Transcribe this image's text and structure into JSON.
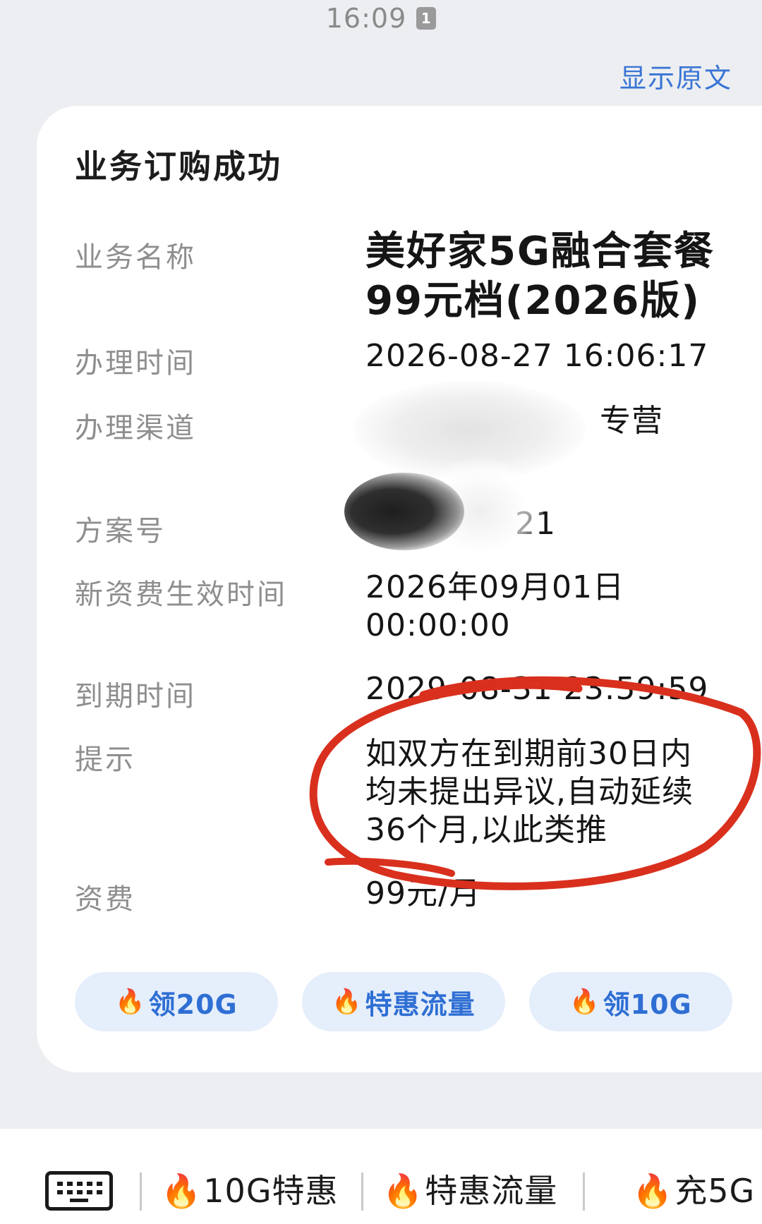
{
  "status_bar": {
    "time": "16:09",
    "notification_badge": "1"
  },
  "header": {
    "show_original": "显示原文"
  },
  "card": {
    "title": "业务订购成功",
    "rows": [
      {
        "label": "业务名称",
        "value_lines": [
          "美好家5G融合套餐",
          "99元档(2026版)"
        ]
      },
      {
        "label": "办理时间",
        "value": "2026-08-27 16:06:17"
      },
      {
        "label": "办理渠道",
        "value": "专营"
      },
      {
        "label": "方案号",
        "value": "21"
      },
      {
        "label": "新资费生效时间",
        "value_lines": [
          "2026年09月01日",
          "00:00:00"
        ]
      },
      {
        "label": "到期时间",
        "value": "2029-08-31 23:59:59"
      },
      {
        "label": "提示",
        "value_lines": [
          "如双方在到期前30日内",
          "均未提出异议,自动延续",
          "36个月,以此类推"
        ]
      },
      {
        "label": "资费",
        "value": "99元/月"
      }
    ],
    "chips": [
      {
        "icon": "fire-icon",
        "label": "领20G"
      },
      {
        "icon": "fire-icon",
        "label": "特惠流量"
      },
      {
        "icon": "fire-icon",
        "label": "领10G"
      }
    ]
  },
  "bottom_menu": {
    "keyboard_icon": "keyboard-icon",
    "items": [
      {
        "icon": "fire-icon",
        "label": "10G特惠"
      },
      {
        "icon": "fire-icon",
        "label": "特惠流量"
      },
      {
        "icon": "fire-icon",
        "label": "充5G"
      }
    ]
  },
  "colors": {
    "accent_blue": "#3a74d4",
    "chip_bg": "#e5eefb",
    "annotation_red": "#d9301e",
    "fire": "#f2601c"
  }
}
